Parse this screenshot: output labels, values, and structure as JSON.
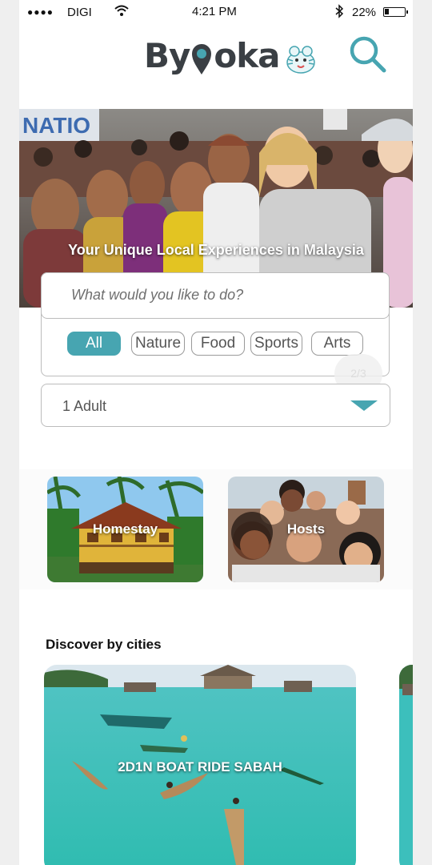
{
  "status_bar": {
    "signal": "●●●●",
    "carrier": "DIGI",
    "time": "4:21 PM",
    "battery": "22%"
  },
  "header": {
    "logo_text_left": "By",
    "logo_text_right": "oka",
    "search_icon": "search-icon"
  },
  "hero": {
    "title": "Your Unique Local Experiences in Malaysia"
  },
  "search": {
    "placeholder": "What would you like to do?",
    "categories": [
      {
        "label": "All",
        "active": true
      },
      {
        "label": "Nature",
        "active": false
      },
      {
        "label": "Food",
        "active": false
      },
      {
        "label": "Sports",
        "active": false
      },
      {
        "label": "Arts",
        "active": false
      }
    ],
    "page_indicator": "2/3",
    "guests": "1 Adult"
  },
  "features": [
    {
      "label": "Homestay"
    },
    {
      "label": "Hosts"
    }
  ],
  "discover": {
    "title": "Discover by cities",
    "cards": [
      {
        "label": "2D1N BOAT RIDE SABAH"
      }
    ]
  },
  "colors": {
    "accent": "#47a5b1",
    "logo_dark": "#3a3f44"
  }
}
